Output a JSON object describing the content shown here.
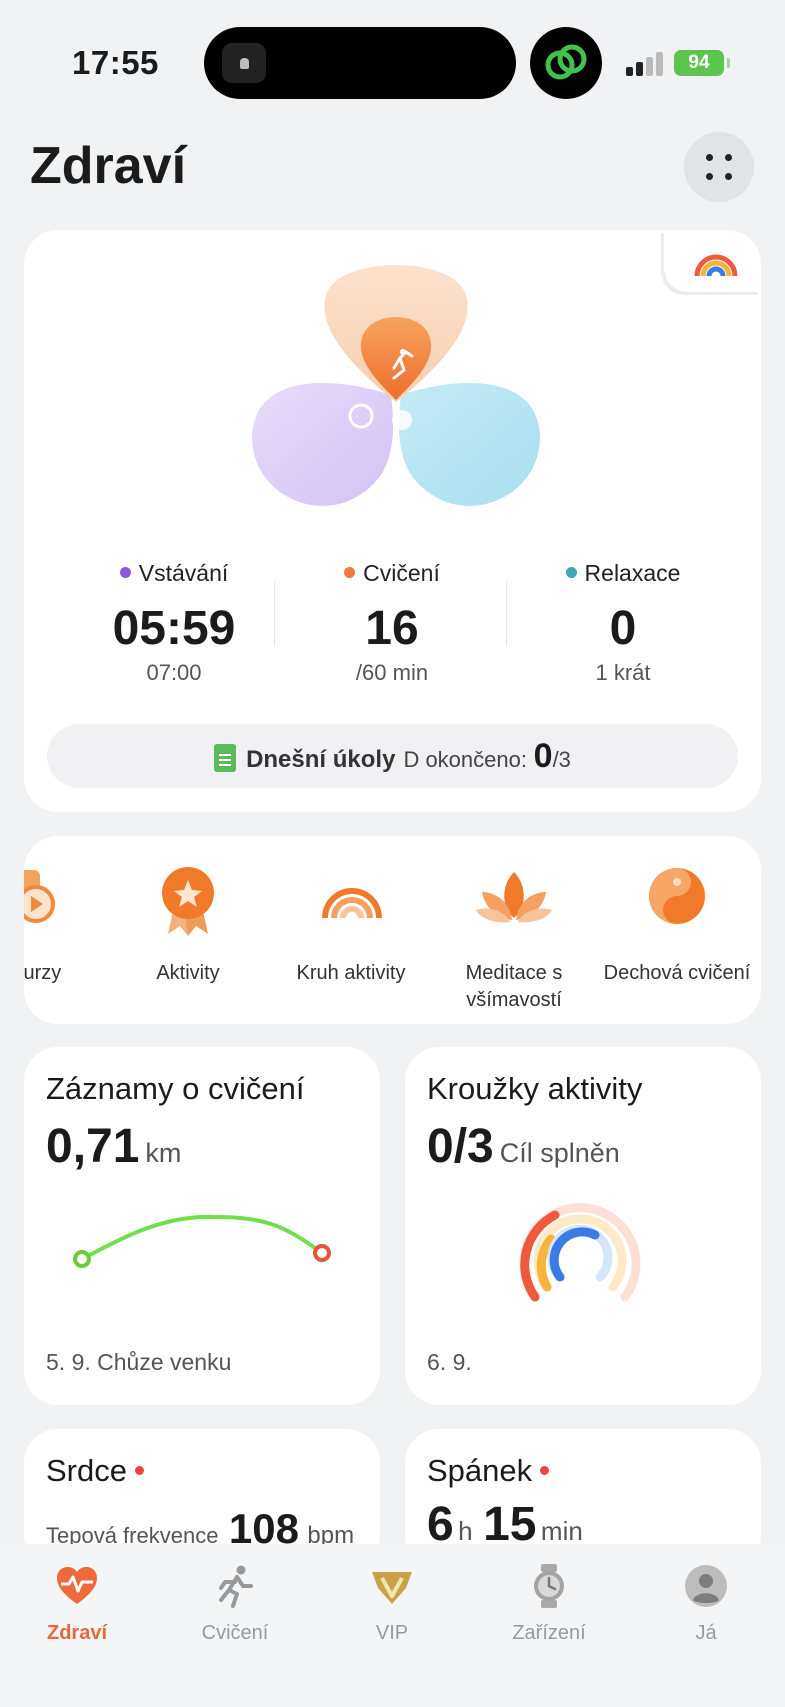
{
  "status_bar": {
    "time": "17:55",
    "battery": "94"
  },
  "header": {
    "title": "Zdraví"
  },
  "activity": {
    "stats": [
      {
        "label": "Vstávání",
        "value": "05:59",
        "sub": "07:00",
        "color": "#8a5ad8"
      },
      {
        "label": "Cvičení",
        "value": "16",
        "sub": "/60 min",
        "color": "#f07a3a"
      },
      {
        "label": "Relaxace",
        "value": "0",
        "sub": "1 krát",
        "color": "#3fa8b8"
      }
    ],
    "tasks": {
      "label": "Dnešní úkoly",
      "prefix": "D okončeno:",
      "done": "0",
      "total": "/3"
    }
  },
  "quick_access": [
    {
      "label": "vé kurzy",
      "icon": "courses-icon"
    },
    {
      "label": "Aktivity",
      "icon": "medal-icon"
    },
    {
      "label": "Kruh aktivity",
      "icon": "activity-ring-icon"
    },
    {
      "label": "Meditace s všímavostí",
      "icon": "lotus-icon"
    },
    {
      "label": "Dechová cvičení",
      "icon": "breathing-icon"
    }
  ],
  "tiles": {
    "exercise": {
      "title": "Záznamy o cvičení",
      "value": "0,71",
      "unit": "km",
      "foot": "5. 9. Chůze venku"
    },
    "rings": {
      "title": "Kroužky aktivity",
      "value": "0/3",
      "unit": "Cíl splněn",
      "foot": "6. 9."
    },
    "heart": {
      "title": "Srdce",
      "prefix": "Tepová frekvence",
      "value": "108",
      "unit": "bpm"
    },
    "sleep": {
      "title": "Spánek",
      "hours": "6",
      "h_unit": "h",
      "minutes": "15",
      "m_unit": "min"
    }
  },
  "nav": [
    {
      "label": "Zdraví",
      "icon": "heart-pulse-icon",
      "active": true
    },
    {
      "label": "Cvičení",
      "icon": "runner-icon",
      "active": false
    },
    {
      "label": "VIP",
      "icon": "vip-icon",
      "active": false
    },
    {
      "label": "Zařízení",
      "icon": "watch-icon",
      "active": false
    },
    {
      "label": "Já",
      "icon": "profile-icon",
      "active": false
    }
  ],
  "colors": {
    "accent": "#e8683a",
    "bg": "#f1f2f4",
    "card": "#ffffff"
  }
}
